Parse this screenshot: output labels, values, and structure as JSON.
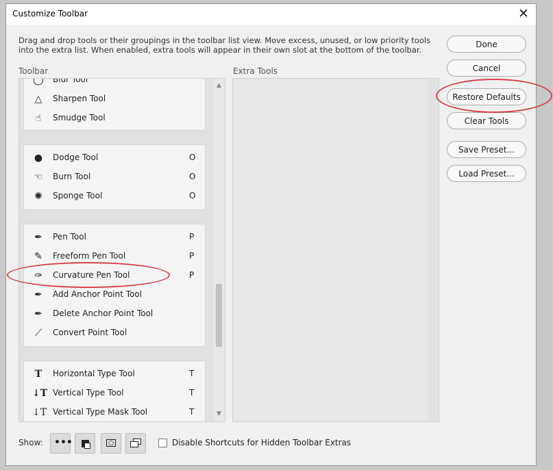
{
  "dialog": {
    "title": "Customize Toolbar",
    "description": "Drag and drop tools or their groupings in the toolbar list view. Move excess, unused, or low priority tools into the extra list. When enabled, extra tools will appear in their own slot at the bottom of the toolbar.",
    "toolbar_label": "Toolbar",
    "extra_tools_label": "Extra Tools"
  },
  "buttons": {
    "done": "Done",
    "cancel": "Cancel",
    "restore_defaults": "Restore Defaults",
    "clear_tools": "Clear Tools",
    "save_preset": "Save Preset...",
    "load_preset": "Load Preset..."
  },
  "toolbar_groups": [
    {
      "items": [
        {
          "label": "Blur Tool",
          "key": "",
          "icon": "blur-icon"
        },
        {
          "label": "Sharpen Tool",
          "key": "",
          "icon": "sharpen-icon"
        },
        {
          "label": "Smudge Tool",
          "key": "",
          "icon": "smudge-icon"
        }
      ]
    },
    {
      "items": [
        {
          "label": "Dodge Tool",
          "key": "O",
          "icon": "dodge-icon"
        },
        {
          "label": "Burn Tool",
          "key": "O",
          "icon": "burn-icon"
        },
        {
          "label": "Sponge Tool",
          "key": "O",
          "icon": "sponge-icon"
        }
      ]
    },
    {
      "items": [
        {
          "label": "Pen Tool",
          "key": "P",
          "icon": "pen-icon"
        },
        {
          "label": "Freeform Pen Tool",
          "key": "P",
          "icon": "freeform-pen-icon"
        },
        {
          "label": "Curvature Pen Tool",
          "key": "P",
          "icon": "curvature-pen-icon"
        },
        {
          "label": "Add Anchor Point Tool",
          "key": "",
          "icon": "add-anchor-icon"
        },
        {
          "label": "Delete Anchor Point Tool",
          "key": "",
          "icon": "delete-anchor-icon"
        },
        {
          "label": "Convert Point Tool",
          "key": "",
          "icon": "convert-point-icon"
        }
      ]
    },
    {
      "items": [
        {
          "label": "Horizontal Type Tool",
          "key": "T",
          "icon": "horizontal-type-icon"
        },
        {
          "label": "Vertical Type Tool",
          "key": "T",
          "icon": "vertical-type-icon"
        },
        {
          "label": "Vertical Type Mask Tool",
          "key": "T",
          "icon": "vertical-type-mask-icon"
        }
      ]
    }
  ],
  "footer": {
    "show_label": "Show:",
    "disable_shortcuts_label": "Disable Shortcuts for Hidden Toolbar Extras",
    "disable_shortcuts_checked": false
  },
  "annotation_color": "#d9414a"
}
